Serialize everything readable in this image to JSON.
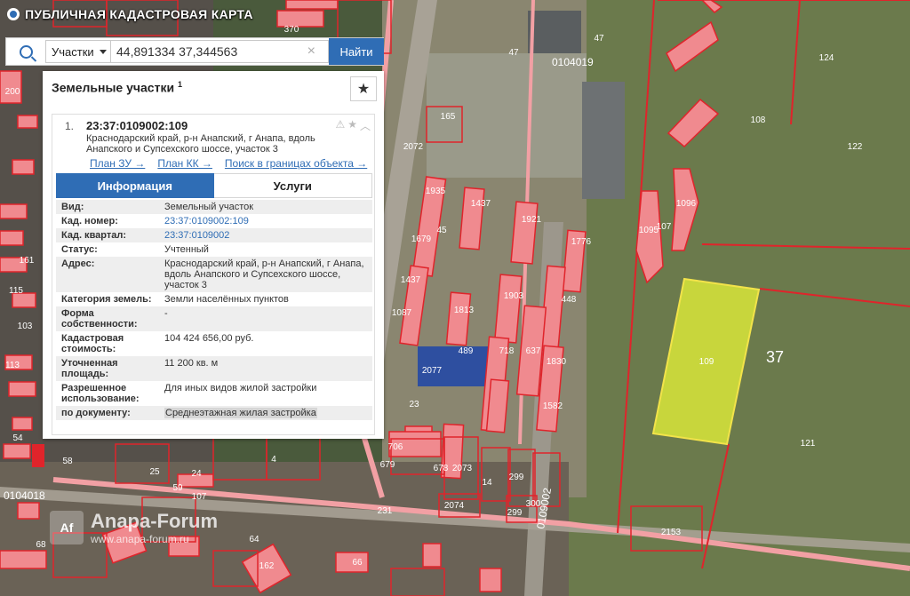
{
  "app": {
    "title": "ПУБЛИЧНАЯ КАДАСТРОВАЯ КАРТА"
  },
  "search": {
    "type": "Участки",
    "value": "44,891334 37,344563",
    "button": "Найти"
  },
  "panel": {
    "title": "Земельные участки",
    "count_sup": "1",
    "result": {
      "index": "1.",
      "number": "23:37:0109002:109",
      "address": "Краснодарский край, р-н Анапский, г Анапа, вдоль Анапского и Супсехского шоссе, участок 3",
      "links": [
        "План ЗУ →",
        "План КК →",
        "Поиск в границах объекта →"
      ]
    },
    "tabs": [
      "Информация",
      "Услуги"
    ],
    "rows": [
      {
        "key": "Вид:",
        "value": "Земельный участок"
      },
      {
        "key": "Кад. номер:",
        "value": "23:37:0109002:109"
      },
      {
        "key": "Кад. квартал:",
        "value": "23:37:0109002"
      },
      {
        "key": "Статус:",
        "value": "Учтенный"
      },
      {
        "key": "Адрес:",
        "value": "Краснодарский край, р-н Анапский, г Анапа, вдоль Анапского и Супсехского шоссе, участок 3"
      },
      {
        "key": "Категория земель:",
        "value": "Земли населённых пунктов"
      },
      {
        "key": "Форма собственности:",
        "value": "-"
      },
      {
        "key": "Кадастровая стоимость:",
        "value": "104 424 656,00 руб."
      },
      {
        "key": "Уточненная площадь:",
        "value": "11 200 кв. м"
      },
      {
        "key": "Разрешенное использование:",
        "value": "Для иных видов жилой застройки"
      },
      {
        "key": "по документу:",
        "value": "Среднеэтажная жилая застройка"
      }
    ]
  },
  "map": {
    "quarter_labels": [
      "0104019",
      "0104018",
      "0109002"
    ],
    "parcel_labels": [
      "370",
      "47",
      "47",
      "165",
      "2072",
      "108",
      "122",
      "124",
      "107",
      "1095",
      "1096",
      "1437",
      "1921",
      "1776",
      "1679",
      "45",
      "1935",
      "1087",
      "1437",
      "1903",
      "489",
      "1813",
      "718",
      "637",
      "1830",
      "1582",
      "448",
      "2077",
      "23",
      "706",
      "679",
      "678",
      "2073",
      "14",
      "299",
      "2074",
      "300",
      "299",
      "231",
      "2153",
      "121",
      "109",
      "37",
      "58",
      "25",
      "24",
      "59",
      "107",
      "4",
      "68",
      "64",
      "162",
      "66",
      "200",
      "161",
      "115",
      "103",
      "113",
      "54"
    ]
  },
  "watermark": {
    "logo": "Af",
    "title": "Anapa-Forum",
    "url": "www.anapa-forum.ru"
  },
  "colors": {
    "accent": "#2f6db5",
    "parcel_fill": "#f08a8f",
    "parcel_stroke": "#e0242b",
    "selected_fill": "#d8e63a"
  }
}
